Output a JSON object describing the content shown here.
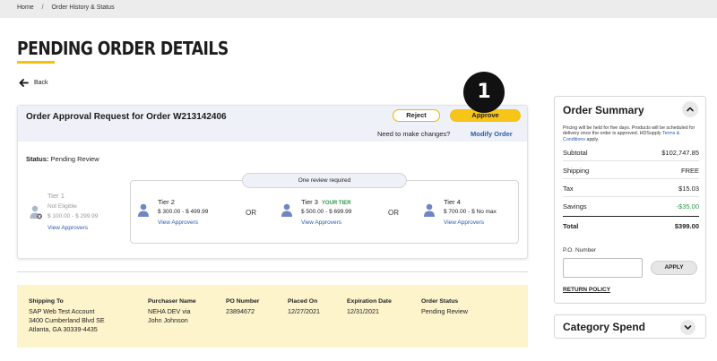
{
  "breadcrumb": {
    "home": "Home",
    "separator": "/",
    "current": "Order History & Status"
  },
  "page": {
    "title": "PENDING ORDER DETAILS",
    "back_label": "Back"
  },
  "approval": {
    "title": "Order Approval Request for Order W213142406",
    "reject_label": "Reject",
    "approve_label": "Approve",
    "changes_prompt": "Need to make changes?",
    "modify_label": "Modify Order",
    "status_label": "Status:",
    "status_value": "Pending Review",
    "review_pill": "One review required",
    "or_label": "OR",
    "tiers": [
      {
        "name": "Tier 1",
        "eligibility": "Not Eligible",
        "range": "$ 100.00 - $ 299.99",
        "link": "View Approvers"
      },
      {
        "name": "Tier 2",
        "range": "$ 300.00 - $ 499.99",
        "link": "View Approvers"
      },
      {
        "name": "Tier 3",
        "badge": "YOUR TIER",
        "range": "$ 500.00 - $ 699.99",
        "link": "View Approvers"
      },
      {
        "name": "Tier 4",
        "range": "$ 700.00 - $ No max",
        "link": "View Approvers"
      }
    ]
  },
  "order_info": {
    "shipping_to": {
      "label": "Shipping To",
      "lines": [
        "SAP Web Test Account",
        "3400 Cumberland Blvd SE",
        "Atlanta, GA 30339-4435"
      ]
    },
    "purchaser": {
      "label": "Purchaser Name",
      "lines": [
        "NEHA DEV via",
        "John Johnson"
      ]
    },
    "po_number": {
      "label": "PO Number",
      "value": "23894672"
    },
    "placed_on": {
      "label": "Placed On",
      "value": "12/27/2021"
    },
    "expiration": {
      "label": "Expiration Date",
      "value": "12/31/2021"
    },
    "status": {
      "label": "Order Status",
      "value": "Pending Review"
    }
  },
  "summary": {
    "title": "Order Summary",
    "note_prefix": "Pricing will be held for five days. Products will be scheduled for delivery once the order is approved. HDSupply",
    "note_link": "Terms & Conditions",
    "note_suffix": "apply.",
    "rows": [
      {
        "label": "Subtotal",
        "value": "$102,747.85"
      },
      {
        "label": "Shipping",
        "value": "FREE"
      },
      {
        "label": "Tax",
        "value": "$15.03"
      },
      {
        "label": "Savings",
        "value": "-$35.00"
      }
    ],
    "total_label": "Total",
    "total_value": "$399.00",
    "po_label": "P.O. Number",
    "po_value": "",
    "apply_label": "APPLY",
    "return_policy_label": "RETURN POLICY"
  },
  "category": {
    "title": "Category Spend"
  },
  "step_badge": "1",
  "colors": {
    "accent_yellow": "#f7c41a",
    "link_blue": "#2a5cab",
    "success_green": "#2e9b4a",
    "info_bar_bg": "#fdf4cc",
    "header_bg": "#eef1f7"
  },
  "icons": [
    "back-arrow-icon",
    "user-icon",
    "chevron-up-icon",
    "chevron-down-icon"
  ]
}
